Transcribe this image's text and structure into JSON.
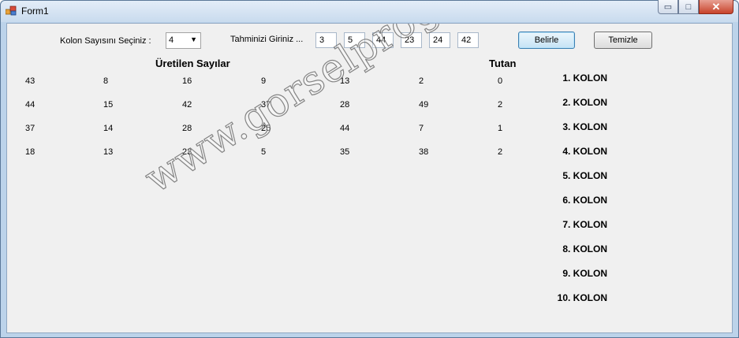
{
  "window": {
    "title": "Form1",
    "minimize": "▭",
    "maximize": "□",
    "close": "✕"
  },
  "form": {
    "kolon_label": "Kolon Sayısını Seçiniz :",
    "kolon_value": "4",
    "tahmin_label": "Tahminizi Giriniz ...",
    "guesses": [
      "3",
      "5",
      "44",
      "23",
      "24",
      "42"
    ],
    "belirle": "Belirle",
    "temizle": "Temizle"
  },
  "results": {
    "header": "Üretilen Sayılar",
    "tutan_header": "Tutan",
    "rows": [
      [
        "43",
        "8",
        "16",
        "9",
        "13",
        "2",
        "0"
      ],
      [
        "44",
        "15",
        "42",
        "37",
        "28",
        "49",
        "2"
      ],
      [
        "37",
        "14",
        "28",
        "25",
        "44",
        "7",
        "1"
      ],
      [
        "18",
        "13",
        "23",
        "5",
        "35",
        "38",
        "2"
      ]
    ]
  },
  "kolon_labels": [
    "1. KOLON",
    "2. KOLON",
    "3. KOLON",
    "4. KOLON",
    "5. KOLON",
    "6. KOLON",
    "7. KOLON",
    "8. KOLON",
    "9. KOLON",
    "10. KOLON"
  ],
  "watermark": "www.gorselprogramlama.com"
}
